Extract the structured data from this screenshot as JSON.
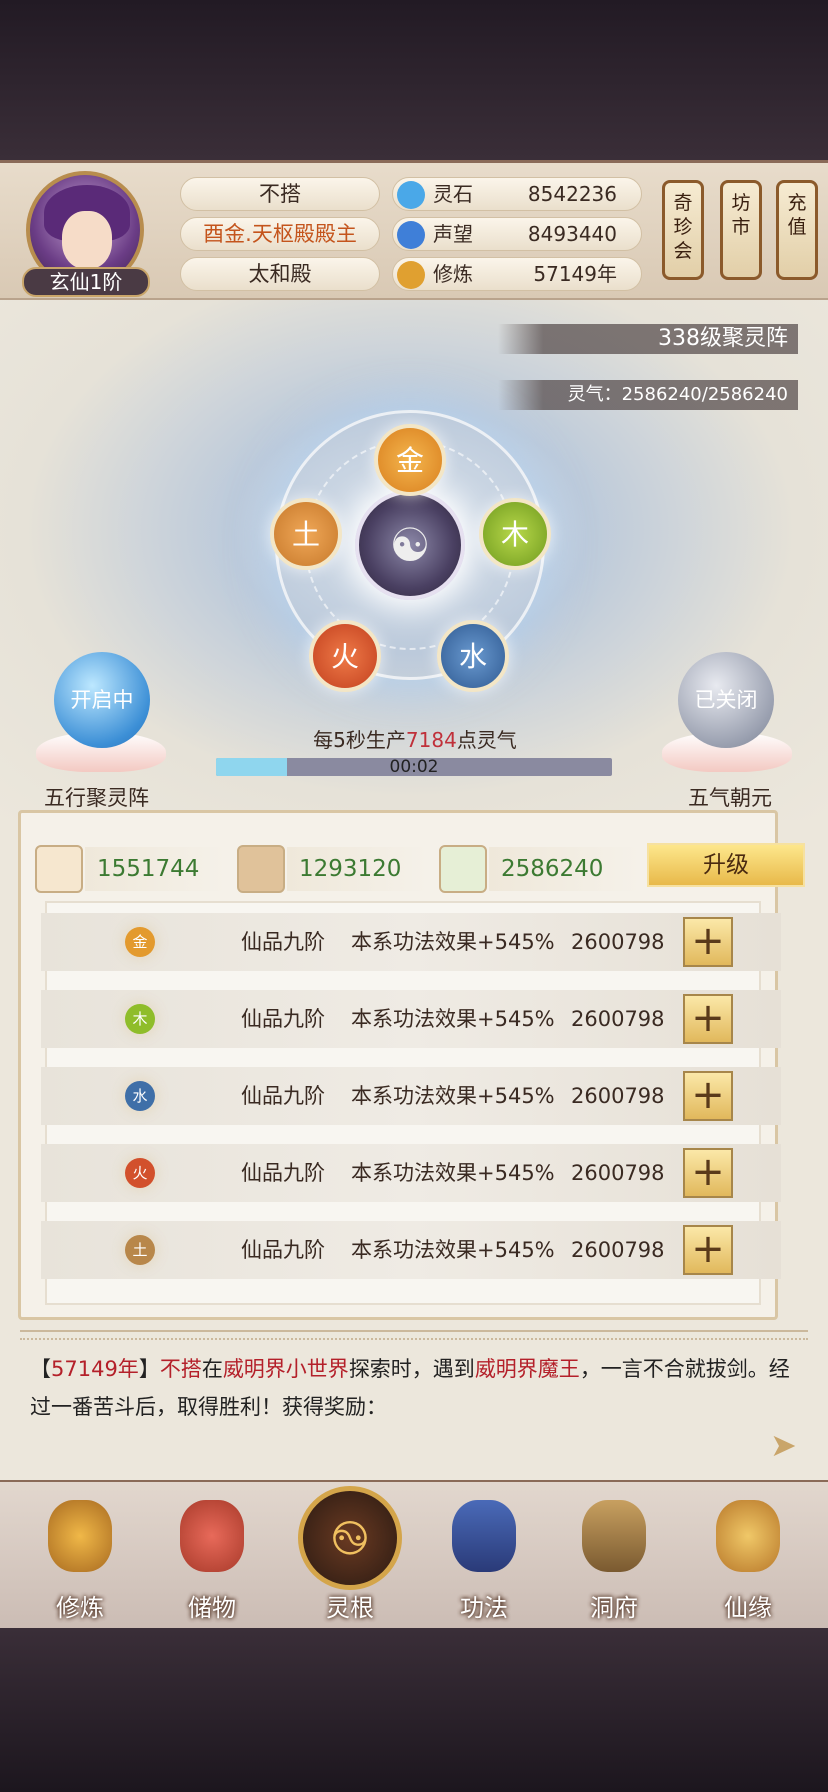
{
  "header": {
    "rank_label": "玄仙1阶",
    "info_pills": [
      "不搭",
      "酉金.天枢殿殿主",
      "太和殿"
    ],
    "resources": [
      {
        "label": "灵石",
        "value": "8542236",
        "icon": "spirit-stone-icon",
        "color": "#4aa8e8"
      },
      {
        "label": "声望",
        "value": "8493440",
        "icon": "prestige-icon",
        "color": "#3f7fd8"
      },
      {
        "label": "修炼",
        "value": "57149年",
        "icon": "cultivation-icon",
        "color": "#e0a030"
      }
    ],
    "scrolls": [
      "奇珍会",
      "坊市",
      "充值"
    ]
  },
  "array": {
    "title": "338级聚灵阵",
    "qi": "灵气：2586240/2586240",
    "elements": [
      "金",
      "木",
      "水",
      "火",
      "土"
    ],
    "element_colors": {
      "金": "#e39a2e",
      "木": "#8fbd2a",
      "水": "#3f6fa8",
      "火": "#d2502c",
      "土": "#d48a3a"
    },
    "left_orb": "开启中",
    "left_caption": "五行聚灵阵",
    "right_orb": "已关闭",
    "right_caption": "五气朝元",
    "production": {
      "prefix": "每5秒生产",
      "amount": "7184",
      "suffix": "点灵气"
    },
    "timer": "00:02",
    "progress": 0.18
  },
  "materials": {
    "items": [
      {
        "icon": "scroll-book-icon",
        "value": "1551744"
      },
      {
        "icon": "wood-log-icon",
        "value": "1293120"
      },
      {
        "icon": "herb-icon",
        "value": "2586240"
      }
    ],
    "upgrade_label": "升级"
  },
  "rows": [
    {
      "element": "金",
      "grade": "仙品九阶",
      "desc": "本系功法效果+545%",
      "value": "2600798",
      "plus": "+"
    },
    {
      "element": "木",
      "grade": "仙品九阶",
      "desc": "本系功法效果+545%",
      "value": "2600798",
      "plus": "+"
    },
    {
      "element": "水",
      "grade": "仙品九阶",
      "desc": "本系功法效果+545%",
      "value": "2600798",
      "plus": "+"
    },
    {
      "element": "火",
      "grade": "仙品九阶",
      "desc": "本系功法效果+545%",
      "value": "2600798",
      "plus": "+"
    },
    {
      "element": "土",
      "grade": "仙品九阶",
      "desc": "本系功法效果+545%",
      "value": "2600798",
      "plus": "+"
    }
  ],
  "log": {
    "open_bracket": "【",
    "year": "57149年",
    "close_bracket": "】",
    "actor": "不搭",
    "t1": "在",
    "place": "威明界小世界",
    "t2": "探索时，遇到",
    "enemy": "威明界魔王",
    "t3": "，一言不合就拔剑。经过一番苦斗后，取得胜利！获得奖励："
  },
  "nav": [
    "修炼",
    "储物",
    "灵根",
    "功法",
    "洞府",
    "仙缘"
  ]
}
